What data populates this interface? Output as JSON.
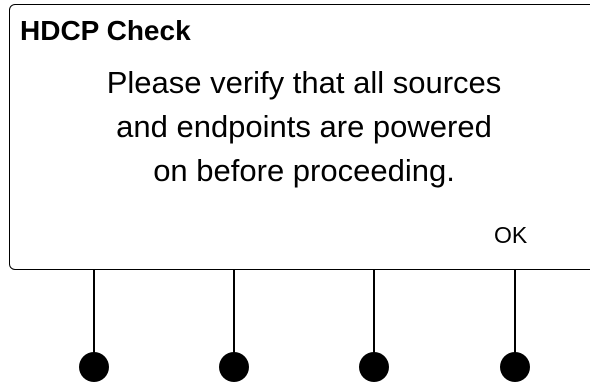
{
  "dialog": {
    "title": "HDCP Check",
    "message_lines": [
      "Please verify that all sources",
      "and endpoints are powered",
      "on before proceeding."
    ],
    "ok_label": "OK"
  },
  "softkeys": [
    "softkey-1",
    "softkey-2",
    "softkey-3",
    "softkey-4"
  ]
}
